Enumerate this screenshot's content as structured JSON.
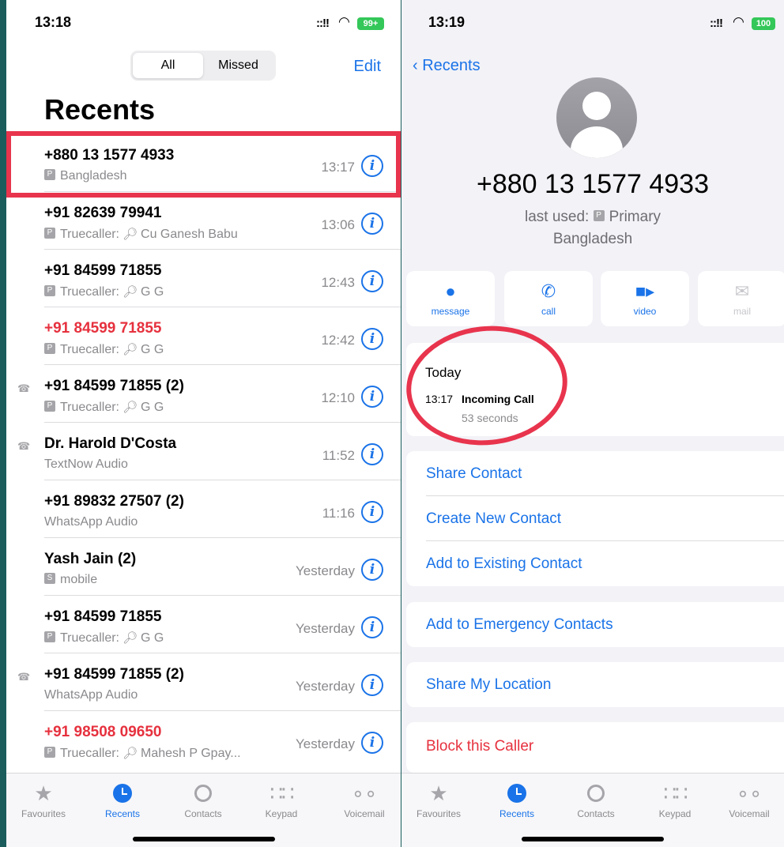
{
  "left": {
    "status": {
      "time": "13:18",
      "signal": "::!!",
      "battery": "99+"
    },
    "segment": {
      "all": "All",
      "missed": "Missed"
    },
    "edit": "Edit",
    "title": "Recents",
    "calls": [
      {
        "name": "+880 13 1577 4933",
        "tag": "P",
        "sub": "Bangladesh",
        "time": "13:17"
      },
      {
        "name": "+91 82639 79941",
        "tag": "P",
        "sub": "Truecaller:",
        "extra": "Cu Ganesh Babu",
        "time": "13:06"
      },
      {
        "name": "+91 84599 71855",
        "tag": "P",
        "sub": "Truecaller:",
        "extra": "G G",
        "time": "12:43"
      },
      {
        "name": "+91 84599 71855",
        "tag": "P",
        "sub": "Truecaller:",
        "extra": "G G",
        "time": "12:42"
      },
      {
        "name": "+91 84599 71855 (2)",
        "tag": "P",
        "sub": "Truecaller:",
        "extra": "G G",
        "time": "12:10"
      },
      {
        "name": "Dr. Harold D'Costa",
        "sub": "TextNow Audio",
        "time": "11:52"
      },
      {
        "name": "+91 89832 27507 (2)",
        "sub": "WhatsApp Audio",
        "time": "11:16"
      },
      {
        "name": "Yash Jain (2)",
        "tag": "S",
        "sub": "mobile",
        "time": "Yesterday"
      },
      {
        "name": "+91 84599 71855",
        "tag": "P",
        "sub": "Truecaller:",
        "extra": "G G",
        "time": "Yesterday"
      },
      {
        "name": "+91 84599 71855 (2)",
        "sub": "WhatsApp Audio",
        "time": "Yesterday"
      },
      {
        "name": "+91 98508 09650",
        "tag": "P",
        "sub": "Truecaller:",
        "extra": "Mahesh P Gpay...",
        "time": "Yesterday"
      }
    ]
  },
  "tabs": {
    "favourites": "Favourites",
    "recents": "Recents",
    "contacts": "Contacts",
    "keypad": "Keypad",
    "voicemail": "Voicemail"
  },
  "right": {
    "status": {
      "time": "13:19",
      "signal": "::!!",
      "battery": "100"
    },
    "back": "Recents",
    "number": "+880 13 1577 4933",
    "last_used_prefix": "last used:",
    "last_used_tag": "P",
    "last_used_line": "Primary",
    "country": "Bangladesh",
    "actions": {
      "message": "message",
      "call": "call",
      "video": "video",
      "mail": "mail"
    },
    "history": {
      "day": "Today",
      "time": "13:17",
      "type": "Incoming Call",
      "duration": "53 seconds"
    },
    "options": {
      "share_contact": "Share Contact",
      "create_new": "Create New Contact",
      "add_existing": "Add to Existing Contact",
      "emergency": "Add to Emergency Contacts",
      "share_location": "Share My Location",
      "block": "Block this Caller"
    }
  },
  "colors": {
    "accent": "#1a73e8",
    "missed": "#e6313e",
    "annotation": "#e8344d",
    "battery": "#34c759"
  }
}
